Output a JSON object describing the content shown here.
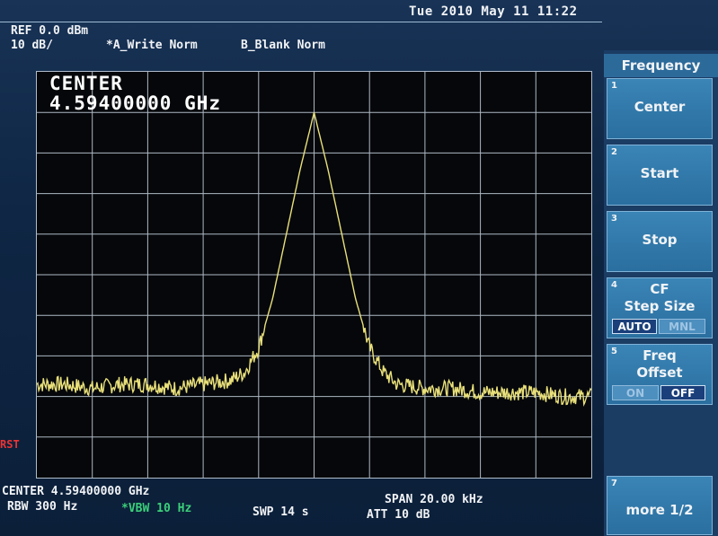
{
  "header": {
    "datetime": "Tue 2010 May 11 11:22",
    "ref_level": "REF 0.0 dBm",
    "scale": "10 dB/",
    "trace_a": "*A_Write Norm",
    "trace_b": "B_Blank Norm"
  },
  "display": {
    "center_label": "CENTER",
    "center_value": "4.59400000 GHz",
    "ref_marker": "RST",
    "trace_color": "#e9e07a",
    "grid_color": "#aeb8c4"
  },
  "footer": {
    "center": "CENTER 4.59400000 GHz",
    "span": "SPAN 20.00 kHz",
    "rbw": "RBW 300 Hz",
    "vbw": "*VBW 10 Hz",
    "swp": "SWP 14 s",
    "att": "ATT 10 dB"
  },
  "softkeys": {
    "title": "Frequency",
    "items": [
      {
        "num": "1",
        "label": "Center"
      },
      {
        "num": "2",
        "label": "Start"
      },
      {
        "num": "3",
        "label": "Stop"
      },
      {
        "num": "4",
        "label": "CF",
        "label2": "Step Size",
        "on": "AUTO",
        "off": "MNL"
      },
      {
        "num": "5",
        "label": "Freq",
        "label2": "Offset",
        "on": "ON",
        "off": "OFF"
      },
      {
        "num": "7",
        "label": "more 1/2"
      }
    ]
  },
  "chart_data": {
    "type": "line",
    "x_unit": "kHz offset from center",
    "y_unit": "dBm",
    "xlim": [
      -10,
      10
    ],
    "ylim": [
      -100,
      0
    ],
    "grid": true,
    "peak": {
      "x": 0,
      "y": -10
    },
    "noise_floor": -78,
    "series": [
      {
        "x": [
          -10,
          -9,
          -8,
          -7,
          -6,
          -5,
          -4,
          -3,
          -2.5,
          -2,
          -1.5,
          -1,
          -0.5,
          0,
          0.5,
          1,
          1.5,
          2,
          2.5,
          3,
          4,
          5,
          6,
          7,
          8,
          9,
          10
        ],
        "y": [
          -77,
          -77,
          -78,
          -77,
          -77,
          -78,
          -77,
          -76,
          -74,
          -68,
          -56,
          -40,
          -24,
          -10,
          -24,
          -40,
          -56,
          -68,
          -74,
          -77,
          -78,
          -78,
          -79,
          -79,
          -79,
          -80,
          -80
        ]
      }
    ]
  }
}
